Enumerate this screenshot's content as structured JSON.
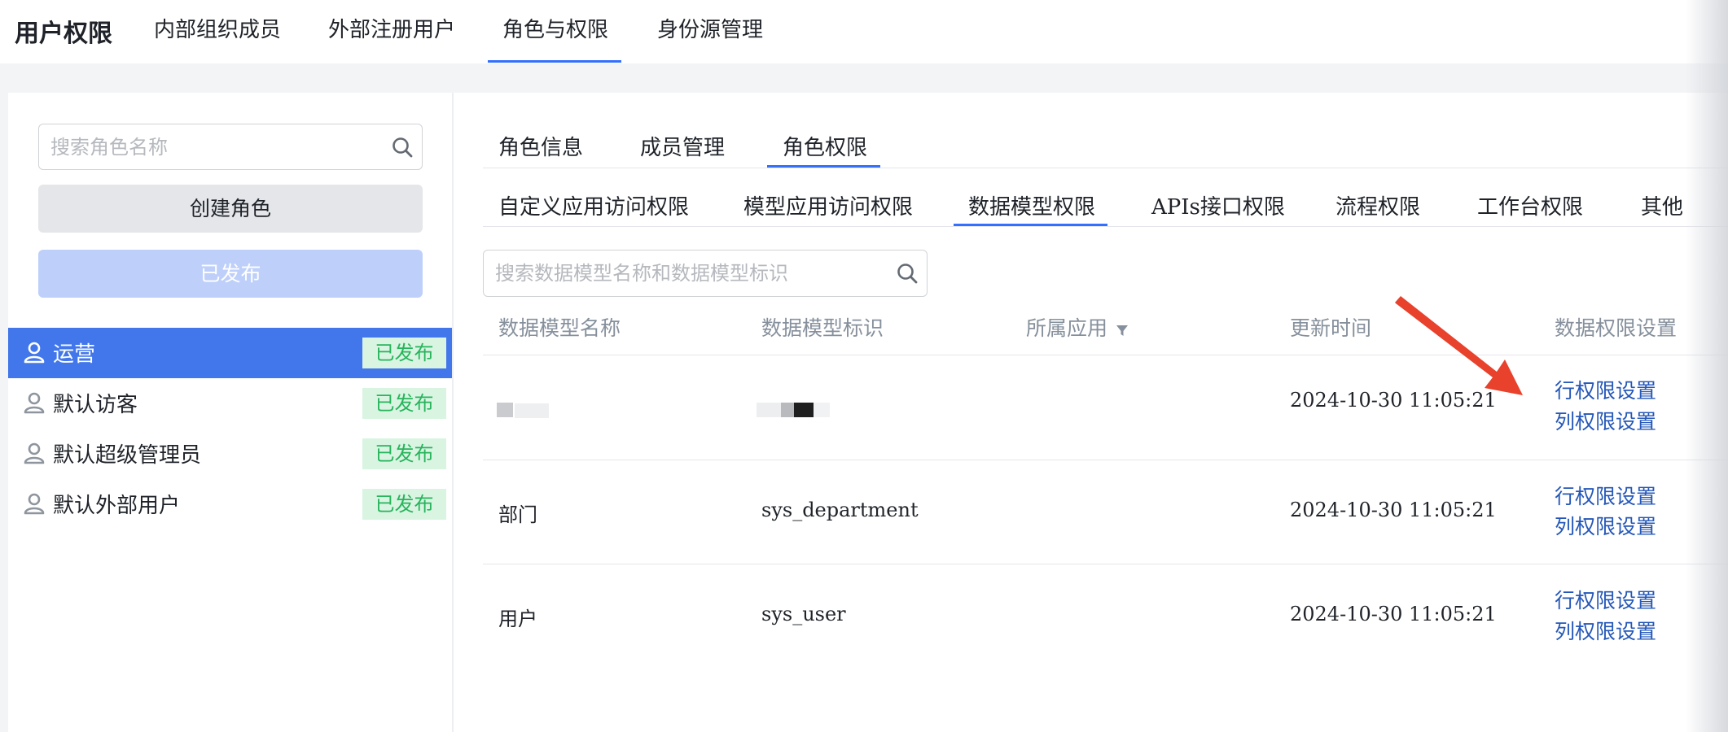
{
  "header": {
    "title": "用户权限",
    "tabs": [
      {
        "label": "内部组织成员"
      },
      {
        "label": "外部注册用户"
      },
      {
        "label": "角色与权限"
      },
      {
        "label": "身份源管理"
      }
    ]
  },
  "sidebar": {
    "search_placeholder": "搜索角色名称",
    "create_button": "创建角色",
    "published_button": "已发布",
    "roles": [
      {
        "label": "运营",
        "badge": "已发布"
      },
      {
        "label": "默认访客",
        "badge": "已发布"
      },
      {
        "label": "默认超级管理员",
        "badge": "已发布"
      },
      {
        "label": "默认外部用户",
        "badge": "已发布"
      }
    ]
  },
  "main": {
    "tabs": [
      {
        "label": "角色信息"
      },
      {
        "label": "成员管理"
      },
      {
        "label": "角色权限"
      }
    ],
    "permission_tabs": [
      {
        "label": "自定义应用访问权限"
      },
      {
        "label": "模型应用访问权限"
      },
      {
        "label": "数据模型权限"
      },
      {
        "label": "APIs接口权限"
      },
      {
        "label": "流程权限"
      },
      {
        "label": "工作台权限"
      },
      {
        "label": "其他"
      }
    ],
    "search_placeholder": "搜索数据模型名称和数据模型标识",
    "table": {
      "headers": [
        "数据模型名称",
        "数据模型标识",
        "所属应用",
        "更新时间",
        "数据权限设置"
      ],
      "rows": [
        {
          "name": "",
          "identifier": "",
          "app": "",
          "updated": "2024-10-30 11:05:21",
          "row_link": "行权限设置",
          "col_link": "列权限设置"
        },
        {
          "name": "部门",
          "identifier": "sys_department",
          "app": "",
          "updated": "2024-10-30 11:05:21",
          "row_link": "行权限设置",
          "col_link": "列权限设置"
        },
        {
          "name": "用户",
          "identifier": "sys_user",
          "app": "",
          "updated": "2024-10-30 11:05:21",
          "row_link": "行权限设置",
          "col_link": "列权限设置"
        }
      ]
    }
  },
  "colors": {
    "accent": "#3370ff",
    "active_role_bg": "#4277eb",
    "badge_bg": "#d9f5e2",
    "badge_text": "#28b45c",
    "link": "#2457b8",
    "annotation_arrow": "#e8412c"
  }
}
